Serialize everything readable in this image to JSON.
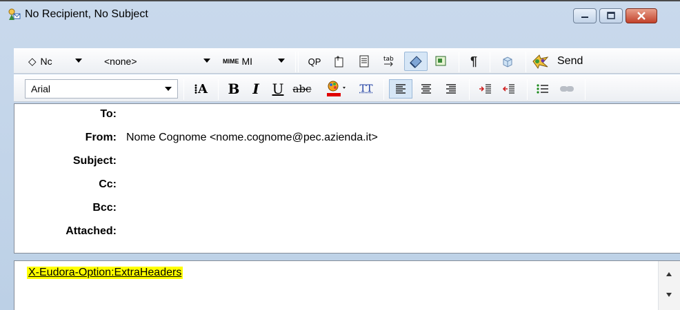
{
  "window": {
    "title": "No Recipient, No Subject",
    "icon": "eudora-compose-icon"
  },
  "toolbar1": {
    "priority_value": "Nc",
    "signature_value": "<none>",
    "mime_prefix": "MIME",
    "mime_value": "MI",
    "qp_label": "QP",
    "send_label": "Send"
  },
  "toolbar2": {
    "font_value": "Arial",
    "bold_label": "B",
    "italic_label": "I",
    "underline_label": "U",
    "strike_label": "abc",
    "teletype_label": "TT",
    "font_size_label": "A"
  },
  "headers": [
    {
      "label": "To:",
      "value": ""
    },
    {
      "label": "From:",
      "value": "Nome Cognome <nome.cognome@pec.azienda.it>"
    },
    {
      "label": "Subject:",
      "value": ""
    },
    {
      "label": "Cc:",
      "value": ""
    },
    {
      "label": "Bcc:",
      "value": ""
    },
    {
      "label": "Attached:",
      "value": ""
    }
  ],
  "body": {
    "text": "X-Eudora-Option:ExtraHeaders"
  },
  "colors": {
    "highlight": "#ffff00",
    "close_button": "#c2412a",
    "text_color_bar": "#e00000"
  }
}
